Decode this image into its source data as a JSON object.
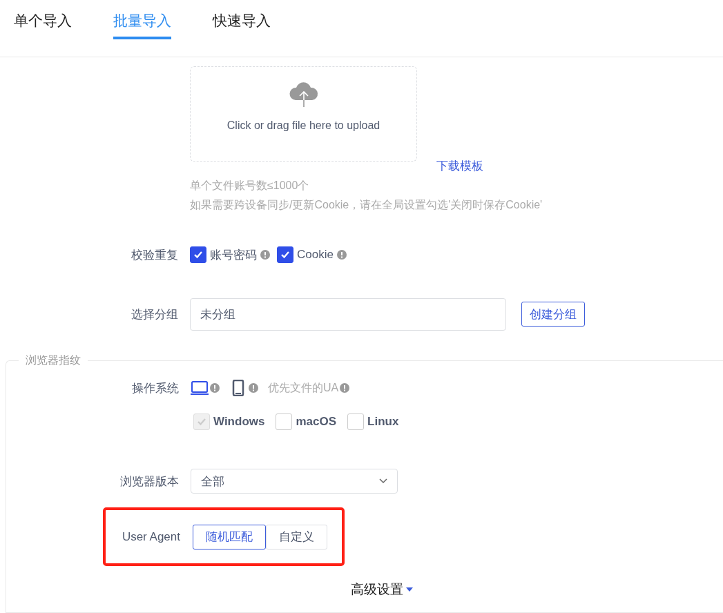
{
  "tabs": [
    {
      "label": "单个导入",
      "selected": false
    },
    {
      "label": "批量导入",
      "selected": true
    },
    {
      "label": "快速导入",
      "selected": false
    }
  ],
  "upload": {
    "text": "Click or drag file here to upload",
    "template_link": "下载模板",
    "hints": [
      "单个文件账号数≤1000个",
      "如果需要跨设备同步/更新Cookie，请在全局设置勾选'关闭时保存Cookie'"
    ]
  },
  "dedupe": {
    "label": "校验重复",
    "options": [
      {
        "label": "账号密码",
        "checked": true
      },
      {
        "label": "Cookie",
        "checked": true
      }
    ]
  },
  "group": {
    "label": "选择分组",
    "value": "未分组",
    "button": "创建分组"
  },
  "fingerprint": {
    "legend": "浏览器指纹",
    "os": {
      "label": "操作系统",
      "devices": [
        {
          "kind": "desktop",
          "selected": true
        },
        {
          "kind": "mobile",
          "selected": false
        },
        {
          "kind": "text",
          "label": "优先文件的UA",
          "selected": false
        }
      ],
      "systems": [
        {
          "label": "Windows",
          "checked": true,
          "disabled": true
        },
        {
          "label": "macOS",
          "checked": false,
          "disabled": false
        },
        {
          "label": "Linux",
          "checked": false,
          "disabled": false
        }
      ]
    },
    "browser_version": {
      "label": "浏览器版本",
      "value": "全部"
    },
    "user_agent": {
      "label": "User Agent",
      "highlighted": true,
      "options": [
        {
          "label": "随机匹配",
          "selected": true
        },
        {
          "label": "自定义",
          "selected": false
        }
      ]
    },
    "advanced": "高级设置"
  }
}
